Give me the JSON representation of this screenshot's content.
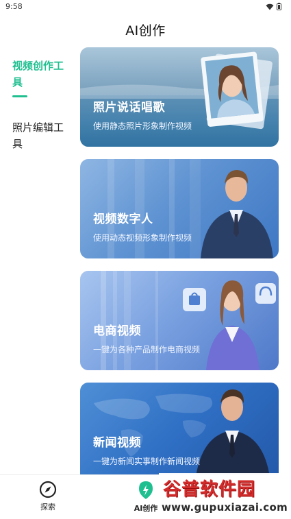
{
  "status_bar": {
    "time": "9:58",
    "wifi_icon": "wifi-icon",
    "battery_icon": "battery-icon"
  },
  "header": {
    "title": "AI创作"
  },
  "sidebar": {
    "items": [
      {
        "label": "视频创作工具",
        "active": true
      },
      {
        "label": "照片编辑工具",
        "active": false
      }
    ],
    "accent_color": "#1fbf8f"
  },
  "cards": [
    {
      "title": "照片说话唱歌",
      "subtitle": "使用静态照片形象制作视频"
    },
    {
      "title": "视频数字人",
      "subtitle": "使用动态视频形象制作视频"
    },
    {
      "title": "电商视频",
      "subtitle": "一键为各种产品制作电商视频"
    },
    {
      "title": "新闻视频",
      "subtitle": "一键为新闻实事制作新闻视频"
    }
  ],
  "bottom_nav": {
    "items": [
      {
        "label": "探索",
        "icon": "compass-icon"
      },
      {
        "label": "AI创作",
        "icon": "ai-spark-icon",
        "active": true
      }
    ]
  },
  "watermark": {
    "name": "谷普软件园",
    "url": "www.gupuxiazai.com"
  }
}
